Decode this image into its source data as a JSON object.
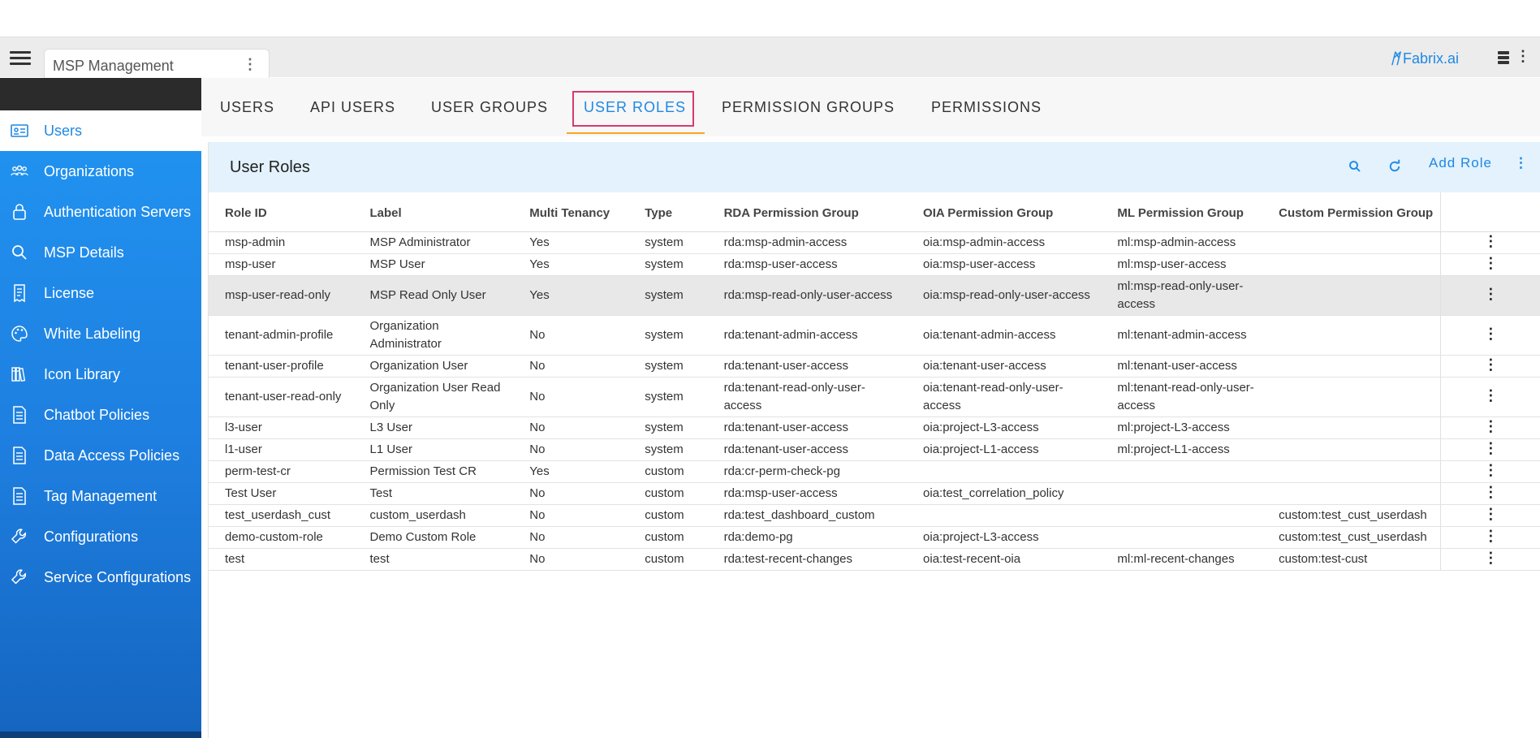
{
  "app": {
    "tab_title": "MSP Management",
    "brand": "Fabrix.ai"
  },
  "sidebar": {
    "items": [
      {
        "label": "Users",
        "icon": "id-card-icon",
        "active": true
      },
      {
        "label": "Organizations",
        "icon": "people-icon"
      },
      {
        "label": "Authentication Servers",
        "icon": "lock-icon"
      },
      {
        "label": "MSP Details",
        "icon": "search-icon"
      },
      {
        "label": "License",
        "icon": "receipt-icon"
      },
      {
        "label": "White Labeling",
        "icon": "palette-icon"
      },
      {
        "label": "Icon Library",
        "icon": "books-icon"
      },
      {
        "label": "Chatbot Policies",
        "icon": "document-icon"
      },
      {
        "label": "Data Access Policies",
        "icon": "document-icon"
      },
      {
        "label": "Tag Management",
        "icon": "document-icon"
      },
      {
        "label": "Configurations",
        "icon": "wrench-icon"
      },
      {
        "label": "Service Configurations",
        "icon": "wrench-icon"
      }
    ]
  },
  "tabs": [
    {
      "label": "USERS"
    },
    {
      "label": "API USERS"
    },
    {
      "label": "USER GROUPS"
    },
    {
      "label": "USER ROLES",
      "active": true
    },
    {
      "label": "PERMISSION GROUPS"
    },
    {
      "label": "PERMISSIONS"
    }
  ],
  "card": {
    "title": "User Roles",
    "add_label": "Add Role"
  },
  "table": {
    "columns": [
      "Role ID",
      "Label",
      "Multi Tenancy",
      "Type",
      "RDA Permission Group",
      "OIA Permission Group",
      "ML Permission Group",
      "Custom Permission Group"
    ],
    "rows": [
      [
        "msp-admin",
        "MSP Administrator",
        "Yes",
        "system",
        "rda:msp-admin-access",
        "oia:msp-admin-access",
        "ml:msp-admin-access",
        ""
      ],
      [
        "msp-user",
        "MSP User",
        "Yes",
        "system",
        "rda:msp-user-access",
        "oia:msp-user-access",
        "ml:msp-user-access",
        ""
      ],
      [
        "msp-user-read-only",
        "MSP Read Only User",
        "Yes",
        "system",
        "rda:msp-read-only-user-access",
        "oia:msp-read-only-user-access",
        "ml:msp-read-only-user-access",
        ""
      ],
      [
        "tenant-admin-profile",
        "Organization Administrator",
        "No",
        "system",
        "rda:tenant-admin-access",
        "oia:tenant-admin-access",
        "ml:tenant-admin-access",
        ""
      ],
      [
        "tenant-user-profile",
        "Organization User",
        "No",
        "system",
        "rda:tenant-user-access",
        "oia:tenant-user-access",
        "ml:tenant-user-access",
        ""
      ],
      [
        "tenant-user-read-only",
        "Organization User Read Only",
        "No",
        "system",
        "rda:tenant-read-only-user-access",
        "oia:tenant-read-only-user-access",
        "ml:tenant-read-only-user-access",
        ""
      ],
      [
        "l3-user",
        "L3 User",
        "No",
        "system",
        "rda:tenant-user-access",
        "oia:project-L3-access",
        "ml:project-L3-access",
        ""
      ],
      [
        "l1-user",
        "L1 User",
        "No",
        "system",
        "rda:tenant-user-access",
        "oia:project-L1-access",
        "ml:project-L1-access",
        ""
      ],
      [
        "perm-test-cr",
        "Permission Test CR",
        "Yes",
        "custom",
        "rda:cr-perm-check-pg",
        "",
        "",
        ""
      ],
      [
        "Test User",
        "Test",
        "No",
        "custom",
        "rda:msp-user-access",
        "oia:test_correlation_policy",
        "",
        ""
      ],
      [
        "test_userdash_cust",
        "custom_userdash",
        "No",
        "custom",
        "rda:test_dashboard_custom",
        "",
        "",
        "custom:test_cust_userdash"
      ],
      [
        "demo-custom-role",
        "Demo Custom Role",
        "No",
        "custom",
        "rda:demo-pg",
        "oia:project-L3-access",
        "",
        "custom:test_cust_userdash"
      ],
      [
        "test",
        "test",
        "No",
        "custom",
        "rda:test-recent-changes",
        "oia:test-recent-oia",
        "ml:ml-recent-changes",
        "custom:test-cust"
      ]
    ],
    "highlighted_row": 2
  }
}
